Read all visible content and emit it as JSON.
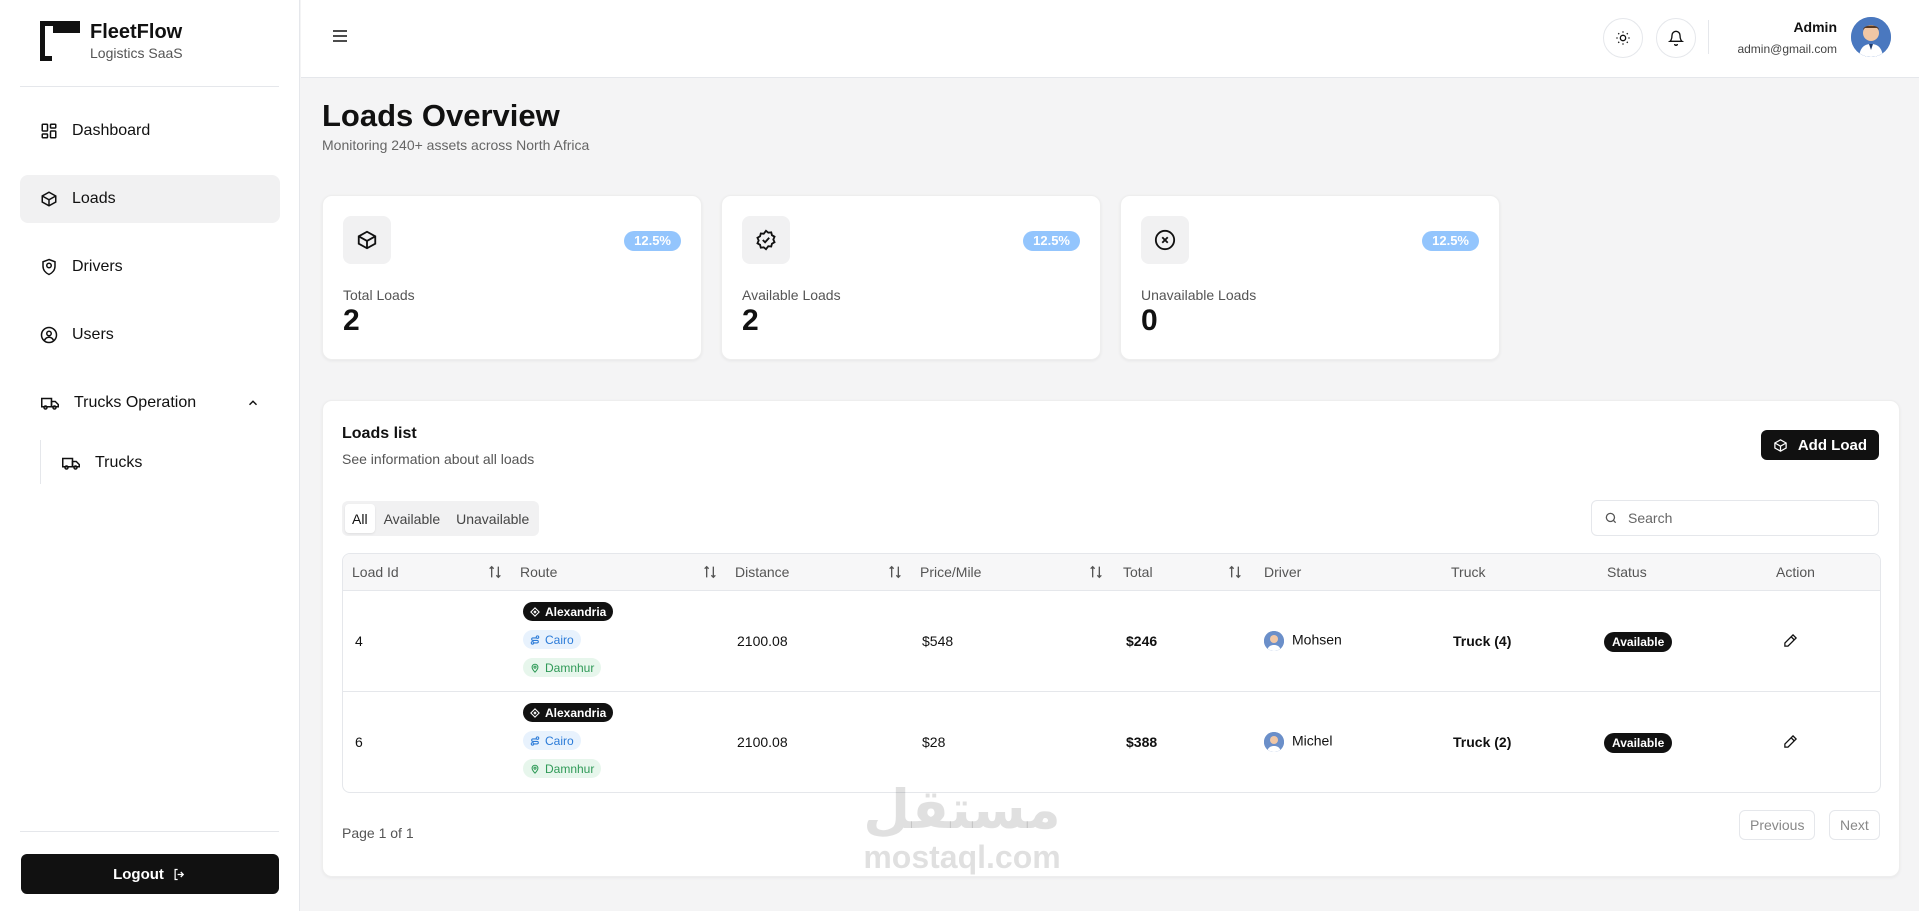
{
  "brand": {
    "name": "FleetFlow",
    "tagline": "Logistics SaaS"
  },
  "sidebar": {
    "items": [
      {
        "label": "Dashboard",
        "icon": "dashboard-icon"
      },
      {
        "label": "Loads",
        "icon": "box-icon",
        "active": true
      },
      {
        "label": "Drivers",
        "icon": "shield-icon"
      },
      {
        "label": "Users",
        "icon": "user-circle-icon"
      },
      {
        "label": "Trucks Operation",
        "icon": "truck-icon",
        "expanded": true
      }
    ],
    "subitems": [
      {
        "label": "Trucks",
        "icon": "truck-icon"
      }
    ],
    "logout_label": "Logout"
  },
  "header": {
    "user_name": "Admin",
    "user_email": "admin@gmail.com"
  },
  "page": {
    "title": "Loads Overview",
    "subtitle": "Monitoring 240+ assets across North Africa"
  },
  "stats": [
    {
      "label": "Total Loads",
      "value": "2",
      "badge": "12.5%",
      "icon": "box-icon"
    },
    {
      "label": "Available Loads",
      "value": "2",
      "badge": "12.5%",
      "icon": "check-badge-icon"
    },
    {
      "label": "Unavailable Loads",
      "value": "0",
      "badge": "12.5%",
      "icon": "x-circle-icon"
    }
  ],
  "loads": {
    "title": "Loads list",
    "subtitle": "See information about all loads",
    "add_label": "Add Load",
    "tabs": [
      "All",
      "Available",
      "Unavailable"
    ],
    "active_tab": "All",
    "search_placeholder": "Search",
    "columns": [
      "Load Id",
      "Route",
      "Distance",
      "Price/Mile",
      "Total",
      "Driver",
      "Truck",
      "Status",
      "Action"
    ],
    "rows": [
      {
        "id": "4",
        "origin": "Alexandria",
        "via": "Cairo",
        "dest": "Damnhur",
        "distance": "2100.08",
        "price": "$548",
        "total": "$246",
        "driver": "Mohsen",
        "truck": "Truck (4)",
        "status": "Available"
      },
      {
        "id": "6",
        "origin": "Alexandria",
        "via": "Cairo",
        "dest": "Damnhur",
        "distance": "2100.08",
        "price": "$28",
        "total": "$388",
        "driver": "Michel",
        "truck": "Truck (2)",
        "status": "Available"
      }
    ],
    "page_info": "Page 1 of 1",
    "prev_label": "Previous",
    "next_label": "Next"
  },
  "watermark": {
    "arabic": "مستقل",
    "latin": "mostaql.com"
  },
  "colors": {
    "accent": "#111111",
    "badge": "#93c5fd",
    "via": "#2b7bd8",
    "dest": "#2f9a57"
  }
}
